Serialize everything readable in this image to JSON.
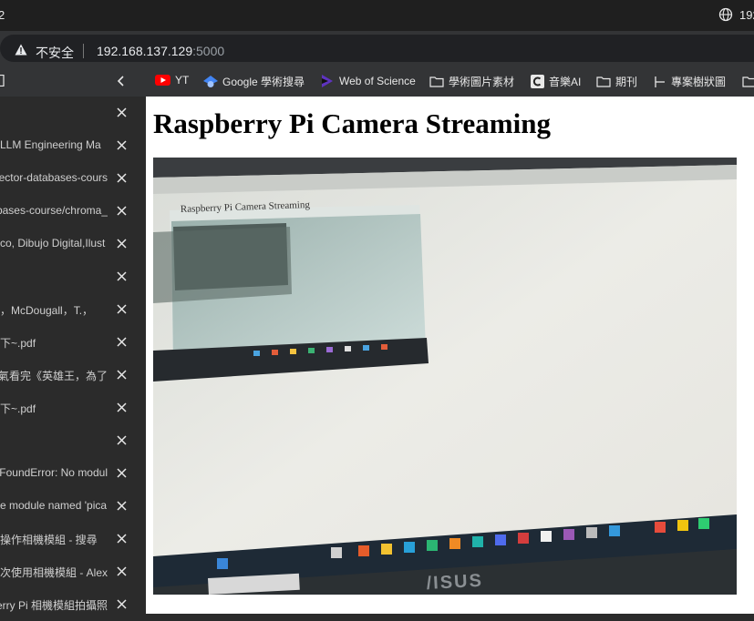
{
  "titlebar": {
    "left_text": "2",
    "right_text": "192",
    "globe_icon": "globe-icon"
  },
  "address": {
    "security_label": "不安全",
    "host": "192.168.137.129",
    "port": ":5000"
  },
  "bookmarks": [
    {
      "label": "YT",
      "icon": "youtube-icon"
    },
    {
      "label": "Google 學術搜尋",
      "icon": "google-scholar-icon"
    },
    {
      "label": "Web of Science",
      "icon": "web-of-science-icon"
    },
    {
      "label": "學術圖片素材",
      "icon": "folder-icon"
    },
    {
      "label": "音樂AI",
      "icon": "app-icon"
    },
    {
      "label": "期刊",
      "icon": "folder-icon"
    },
    {
      "label": "專案樹狀圖",
      "icon": "tree-icon"
    }
  ],
  "tabs": [
    {
      "label": ""
    },
    {
      "label": "LLM Engineering Ma"
    },
    {
      "label": "ector-databases-cours"
    },
    {
      "label": "bases-course/chroma_"
    },
    {
      "label": "co, Dibujo Digital,Ilust"
    },
    {
      "label": ""
    },
    {
      "label": "，McDougall，T.，"
    },
    {
      "label": "下~.pdf"
    },
    {
      "label": "氣看完《英雄王，為了"
    },
    {
      "label": "下~.pdf"
    },
    {
      "label": ""
    },
    {
      "label": "FoundError: No modul"
    },
    {
      "label": "e module named 'pica"
    },
    {
      "label": "操作相機模組 - 搜尋"
    },
    {
      "label": "次使用相機模組 - Alex"
    },
    {
      "label": "erry Pi 相機模組拍攝照"
    }
  ],
  "page": {
    "heading": "Raspberry Pi Camera Streaming",
    "stream_inner_heading": "Raspberry Pi Camera Streaming",
    "monitor_brand": "/ISUS"
  },
  "colors": {
    "accent": "#202124",
    "page_bg": "#ffffff",
    "panel_bg": "#2b2b2b"
  }
}
